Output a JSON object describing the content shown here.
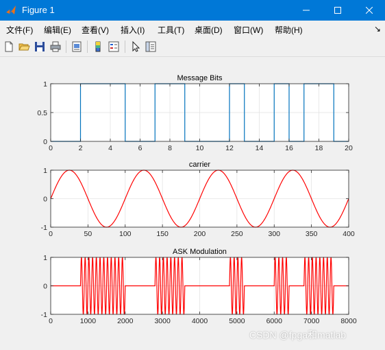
{
  "window": {
    "title": "Figure 1"
  },
  "menu": [
    {
      "label": "文件(F)"
    },
    {
      "label": "编辑(E)"
    },
    {
      "label": "查看(V)"
    },
    {
      "label": "插入(I)"
    },
    {
      "label": "工具(T)"
    },
    {
      "label": "桌面(D)"
    },
    {
      "label": "窗口(W)"
    },
    {
      "label": "帮助(H)"
    }
  ],
  "menu_arrow": "↘",
  "toolbar": [
    "new-file-icon",
    "open-folder-icon",
    "save-icon",
    "print-icon",
    "print-preview-icon",
    "colorbar-icon",
    "legend-icon",
    "select-arrow-icon",
    "property-inspector-icon"
  ],
  "watermark": "CSDN @fpga和matlab",
  "chart_data": [
    {
      "type": "line",
      "title": "Message Bits",
      "color": "#0072bd",
      "xlim": [
        0,
        20
      ],
      "ylim": [
        0,
        1
      ],
      "xticks": [
        0,
        2,
        4,
        6,
        8,
        10,
        12,
        14,
        16,
        18,
        20
      ],
      "yticks": [
        0,
        0.5,
        1
      ],
      "bits": [
        0,
        0,
        1,
        1,
        1,
        0,
        0,
        1,
        1,
        0,
        0,
        0,
        1,
        0,
        0,
        1,
        0,
        1,
        1,
        0
      ],
      "grid": true
    },
    {
      "type": "line",
      "title": "carrier",
      "color": "#ff0000",
      "xlim": [
        0,
        400
      ],
      "ylim": [
        -1,
        1
      ],
      "xticks": [
        0,
        50,
        100,
        150,
        200,
        250,
        300,
        350,
        400
      ],
      "yticks": [
        -1,
        0,
        1
      ],
      "period": 100,
      "grid": true
    },
    {
      "type": "line",
      "title": "ASK Modulation",
      "color": "#ff0000",
      "xlim": [
        0,
        8000
      ],
      "ylim": [
        -1,
        1
      ],
      "xticks": [
        0,
        1000,
        2000,
        3000,
        4000,
        5000,
        6000,
        7000,
        8000
      ],
      "yticks": [
        -1,
        0,
        1
      ],
      "samples_per_bit": 400,
      "carrier_period": 100,
      "grid": true
    }
  ]
}
